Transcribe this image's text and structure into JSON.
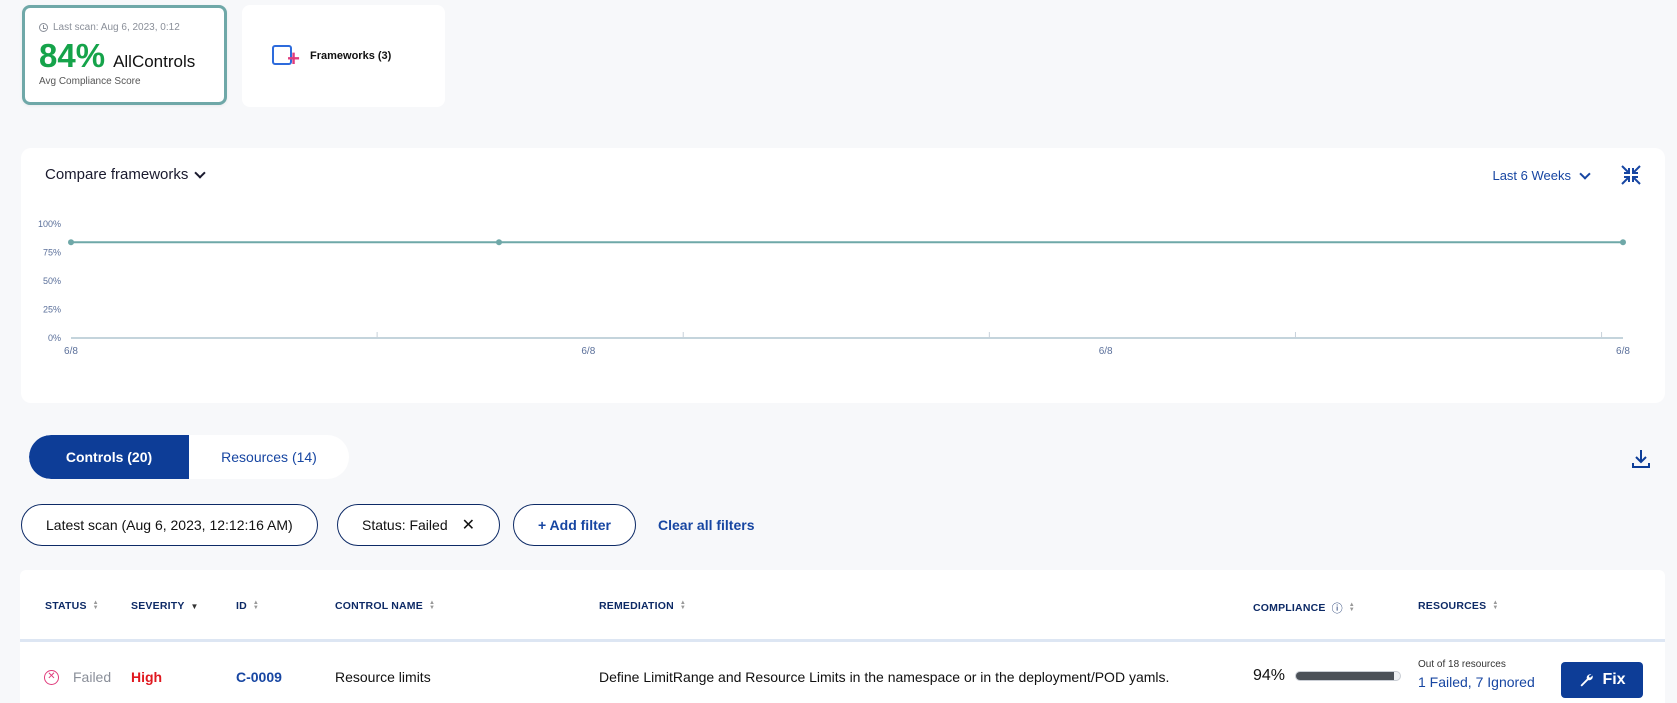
{
  "score_card": {
    "last_scan": "Last scan: Aug 6, 2023, 0:12",
    "percent": "84%",
    "name": "AllControls",
    "subtitle": "Avg Compliance Score"
  },
  "frameworks_card": {
    "label": "Frameworks (3)"
  },
  "chart_header": {
    "compare_label": "Compare frameworks",
    "range_label": "Last 6 Weeks"
  },
  "chart_data": {
    "type": "line",
    "x": [
      "6/8",
      "6/8",
      "6/8",
      "6/8"
    ],
    "series": [
      {
        "values": [
          84,
          84,
          84
        ]
      }
    ],
    "y_ticks": [
      "100%",
      "75%",
      "50%",
      "25%",
      "0%"
    ],
    "ylim": [
      0,
      100
    ],
    "grid": false,
    "color": "#6fa8a8"
  },
  "tabs": [
    {
      "label": "Controls (20)",
      "active": true
    },
    {
      "label": "Resources (14)",
      "active": false
    }
  ],
  "filters": {
    "scan_chip": "Latest scan (Aug 6, 2023, 12:12:16 AM)",
    "status_chip": "Status: Failed",
    "add_filter": "+ Add filter",
    "clear_all": "Clear all filters"
  },
  "table": {
    "headers": [
      "STATUS",
      "SEVERITY",
      "ID",
      "CONTROL NAME",
      "REMEDIATION",
      "COMPLIANCE",
      "RESOURCES"
    ],
    "rows": [
      {
        "status": "Failed",
        "severity": "High",
        "id": "C-0009",
        "control_name": "Resource limits",
        "remediation": "Define LimitRange and Resource Limits in the namespace or in the deployment/POD yamls.",
        "compliance": "94%",
        "compliance_value": 0.94,
        "resources_out_of": "Out of 18 resources",
        "resources_summary": "1 Failed, 7 Ignored",
        "fix_label": "Fix"
      }
    ]
  },
  "colors": {
    "accent": "#0d3d97",
    "success": "#15a34a",
    "danger": "#e0181f",
    "chart_line": "#6fa8a8"
  }
}
